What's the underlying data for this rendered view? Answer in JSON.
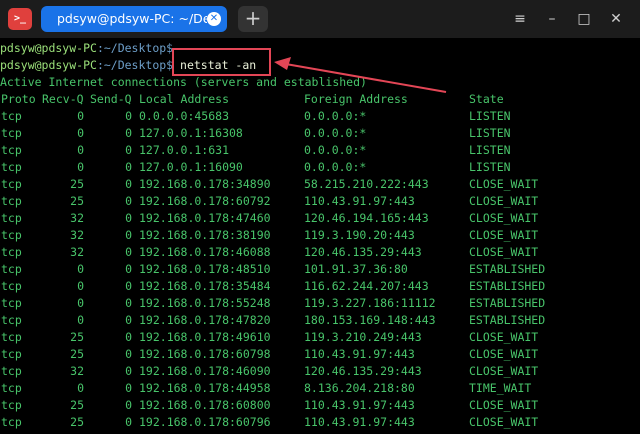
{
  "window": {
    "tab_title": "pdsyw@pdsyw-PC: ~/Desktop",
    "new_tab": "+",
    "app_icon": ">_",
    "buttons": {
      "menu": "≡",
      "minimize": "–",
      "maximize": "□",
      "close": "✕"
    }
  },
  "terminal": {
    "prompt_user": "pdsyw@pdsyw-PC",
    "prompt_path": ":~/Desktop$",
    "command": " netstat -an",
    "header_line": "Active Internet connections (servers and established)",
    "columns": [
      "Proto",
      "Recv-Q",
      "Send-Q",
      "Local Address",
      "Foreign Address",
      "State"
    ],
    "rows": [
      [
        "tcp",
        "0",
        "0",
        "0.0.0.0:45683",
        "0.0.0.0:*",
        "LISTEN"
      ],
      [
        "tcp",
        "0",
        "0",
        "127.0.0.1:16308",
        "0.0.0.0:*",
        "LISTEN"
      ],
      [
        "tcp",
        "0",
        "0",
        "127.0.0.1:631",
        "0.0.0.0:*",
        "LISTEN"
      ],
      [
        "tcp",
        "0",
        "0",
        "127.0.0.1:16090",
        "0.0.0.0:*",
        "LISTEN"
      ],
      [
        "tcp",
        "25",
        "0",
        "192.168.0.178:34890",
        "58.215.210.222:443",
        "CLOSE_WAIT"
      ],
      [
        "tcp",
        "25",
        "0",
        "192.168.0.178:60792",
        "110.43.91.97:443",
        "CLOSE_WAIT"
      ],
      [
        "tcp",
        "32",
        "0",
        "192.168.0.178:47460",
        "120.46.194.165:443",
        "CLOSE_WAIT"
      ],
      [
        "tcp",
        "32",
        "0",
        "192.168.0.178:38190",
        "119.3.190.20:443",
        "CLOSE_WAIT"
      ],
      [
        "tcp",
        "32",
        "0",
        "192.168.0.178:46088",
        "120.46.135.29:443",
        "CLOSE_WAIT"
      ],
      [
        "tcp",
        "0",
        "0",
        "192.168.0.178:48510",
        "101.91.37.36:80",
        "ESTABLISHED"
      ],
      [
        "tcp",
        "0",
        "0",
        "192.168.0.178:35484",
        "116.62.244.207:443",
        "ESTABLISHED"
      ],
      [
        "tcp",
        "0",
        "0",
        "192.168.0.178:55248",
        "119.3.227.186:11112",
        "ESTABLISHED"
      ],
      [
        "tcp",
        "0",
        "0",
        "192.168.0.178:47820",
        "180.153.169.148:443",
        "ESTABLISHED"
      ],
      [
        "tcp",
        "25",
        "0",
        "192.168.0.178:49610",
        "119.3.210.249:443",
        "CLOSE_WAIT"
      ],
      [
        "tcp",
        "25",
        "0",
        "192.168.0.178:60798",
        "110.43.91.97:443",
        "CLOSE_WAIT"
      ],
      [
        "tcp",
        "32",
        "0",
        "192.168.0.178:46090",
        "120.46.135.29:443",
        "CLOSE_WAIT"
      ],
      [
        "tcp",
        "0",
        "0",
        "192.168.0.178:44958",
        "8.136.204.218:80",
        "TIME_WAIT"
      ],
      [
        "tcp",
        "25",
        "0",
        "192.168.0.178:60800",
        "110.43.91.97:443",
        "CLOSE_WAIT"
      ],
      [
        "tcp",
        "25",
        "0",
        "192.168.0.178:60796",
        "110.43.91.97:443",
        "CLOSE_WAIT"
      ]
    ]
  },
  "colors": {
    "titlebar": "#1c1c1c",
    "tab": "#1a73e8",
    "terminal_bg": "#000000",
    "output_text": "#48c46a",
    "annotation": "#e34656"
  }
}
